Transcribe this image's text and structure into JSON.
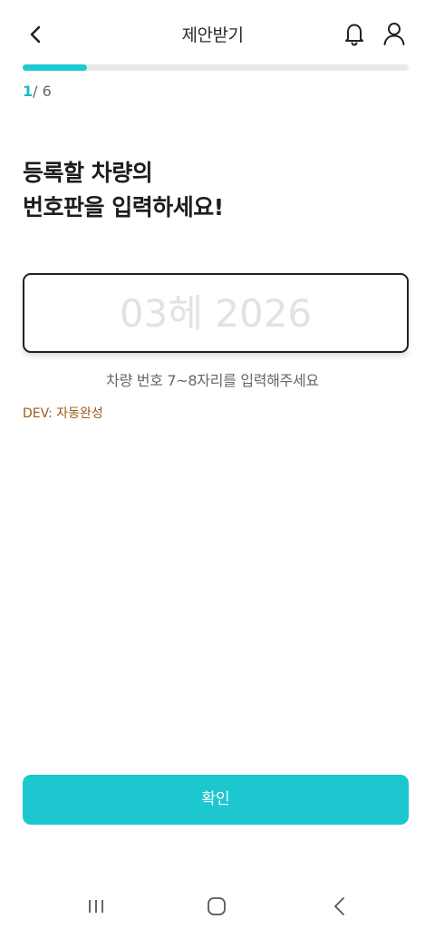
{
  "header": {
    "title": "제안받기",
    "back_icon": "chevron-left-icon",
    "bell_icon": "bell-icon",
    "user_icon": "user-icon"
  },
  "progress": {
    "current": "1",
    "total": "/ 6",
    "fraction": 0.167,
    "accent_color": "#1ec9d2"
  },
  "heading": {
    "line1": "등록할 차량의",
    "line2": "번호판을 입력하세요!"
  },
  "plate_input": {
    "value": "",
    "placeholder": "03헤 2026"
  },
  "hint": "차량 번호 7~8자리를 입력해주세요",
  "dev_link": "DEV: 자동완성",
  "confirm_button": "확인",
  "system_nav": {
    "recent_icon": "recent-apps-icon",
    "home_icon": "home-icon",
    "back_icon": "back-icon"
  }
}
